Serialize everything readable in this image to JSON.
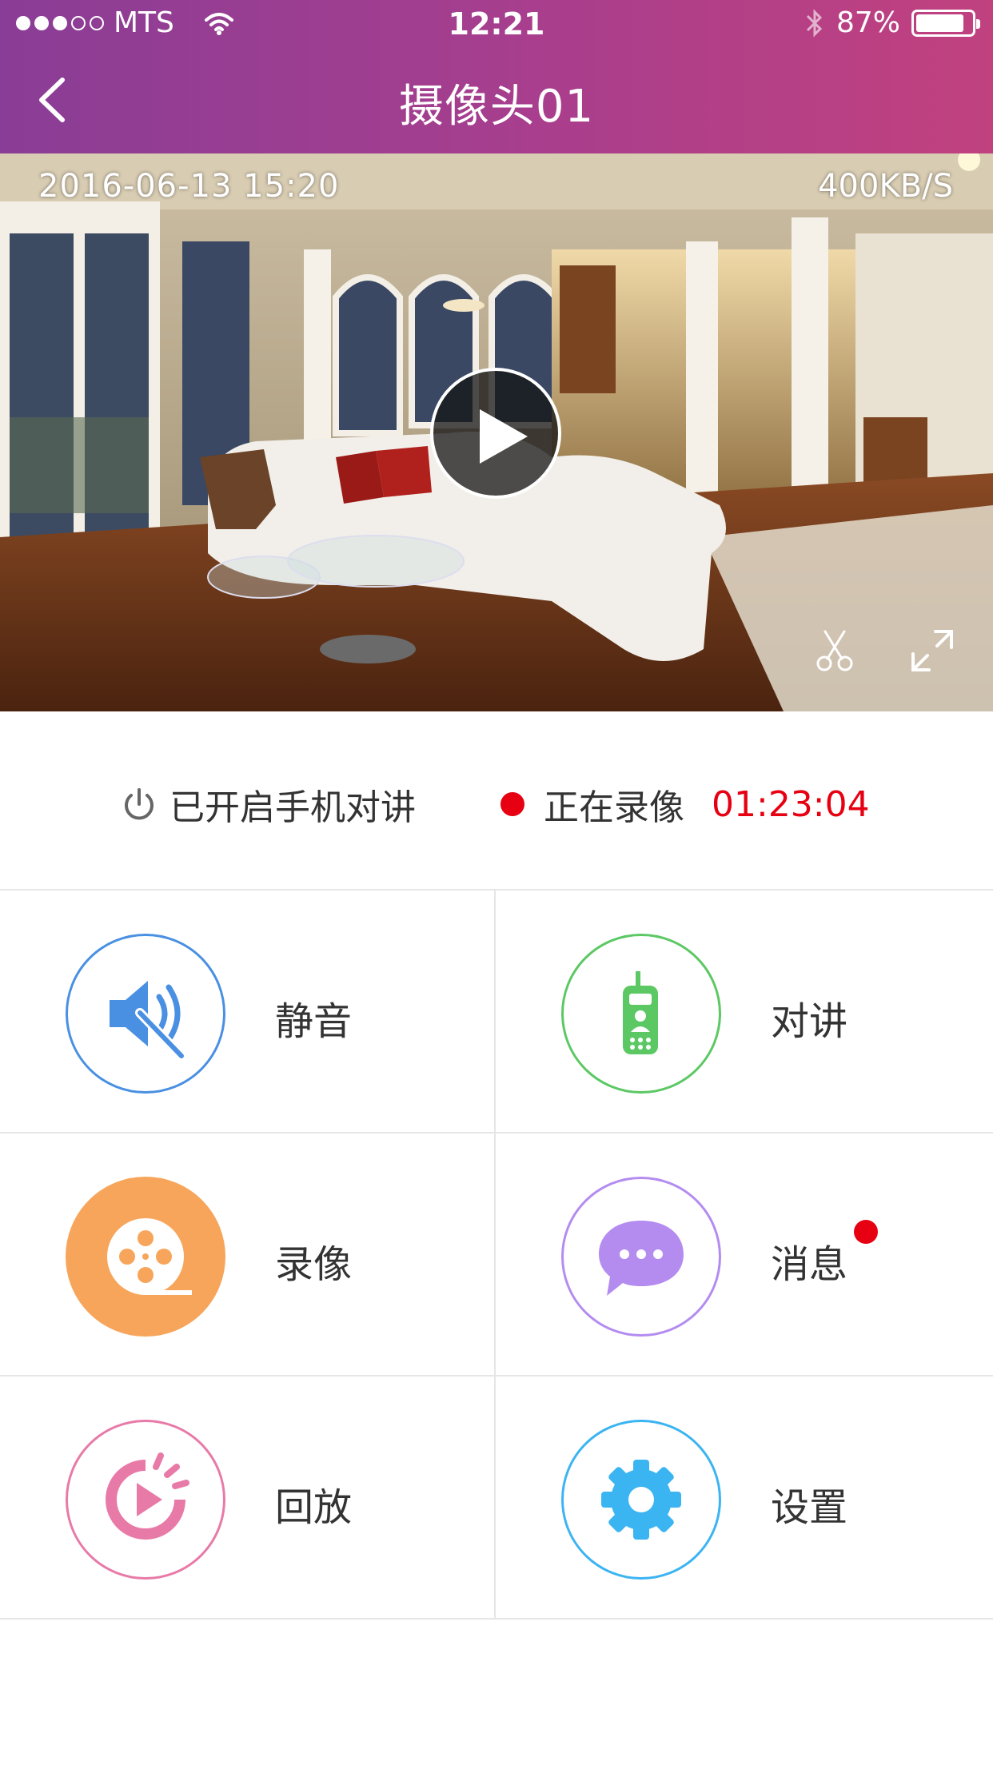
{
  "status_bar": {
    "carrier": "MTS",
    "time": "12:21",
    "battery_percent": "87%",
    "battery_level": 0.87,
    "signal_bars_filled": 3,
    "signal_bars_total": 5
  },
  "nav": {
    "title": "摄像头01",
    "back_icon": "chevron-left-icon"
  },
  "video": {
    "timestamp": "2016-06-13  15:20",
    "speed": "400KB/S",
    "play_icon": "play-icon",
    "clip_icon": "scissors-icon",
    "fullscreen_icon": "expand-icon"
  },
  "status": {
    "intercom_label": "已开启手机对讲",
    "intercom_icon": "power-icon",
    "recording_label": "正在录像",
    "recording_time": "01:23:04"
  },
  "functions": [
    {
      "label": "静音",
      "icon": "speaker-mute-icon",
      "color": "#4a90e2"
    },
    {
      "label": "对讲",
      "icon": "walkie-talkie-icon",
      "color": "#5cc864"
    },
    {
      "label": "录像",
      "icon": "film-reel-icon",
      "color": "#f7a55a"
    },
    {
      "label": "消息",
      "icon": "chat-bubble-icon",
      "color": "#b48cf0",
      "badge": true
    },
    {
      "label": "回放",
      "icon": "playback-icon",
      "color": "#e87aa8"
    },
    {
      "label": "设置",
      "icon": "gear-icon",
      "color": "#3bb4f2"
    }
  ],
  "colors": {
    "header_gradient_start": "#8a3d96",
    "header_gradient_end": "#c1417f",
    "recording_red": "#e60012"
  }
}
